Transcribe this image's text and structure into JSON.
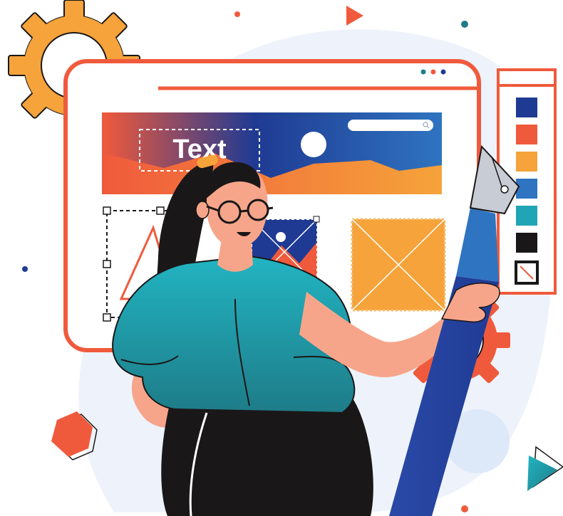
{
  "banner": {
    "text": "Text"
  },
  "colors": {
    "navy": "#1f3a93",
    "blue": "#2f74c0",
    "coral": "#f05a3c",
    "orange": "#f5a33a",
    "teal": "#1fa5b5",
    "dark_teal": "#1e7c88",
    "black": "#1a1718",
    "skin": "#f7a58a",
    "bg_blob": "#eef3fb"
  },
  "palette": {
    "swatches": [
      "navy",
      "coral",
      "orange",
      "blue",
      "teal",
      "black",
      "none"
    ]
  }
}
